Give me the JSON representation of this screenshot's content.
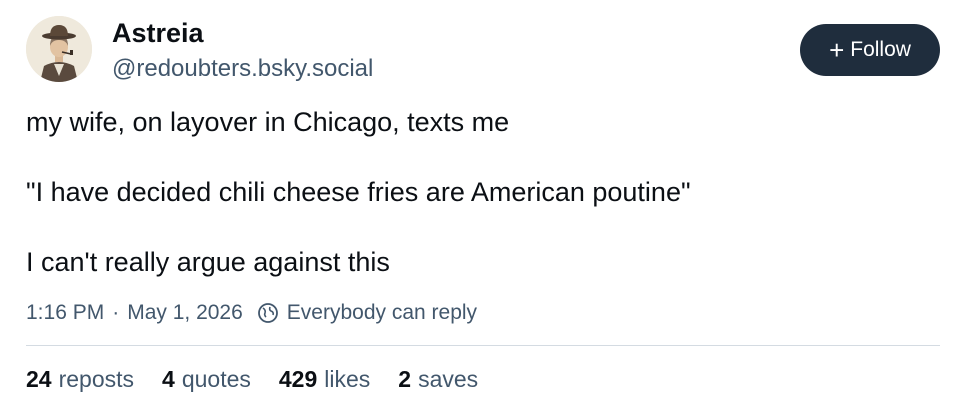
{
  "author": {
    "display_name": "Astreia",
    "handle": "@redoubters.bsky.social",
    "avatar_icon": "avatar-image"
  },
  "follow": {
    "icon": "+",
    "label": "Follow",
    "bg_color": "#1f2d3d"
  },
  "post": {
    "paragraphs": [
      "my wife, on layover in Chicago, texts me",
      "\"I have decided chili cheese fries are American poutine\"",
      "I can't really argue against this"
    ],
    "time": "1:16 PM",
    "separator": "·",
    "date": "May 1, 2026",
    "reply_setting": "Everybody can reply",
    "reply_setting_icon": "globe-icon"
  },
  "stats": [
    {
      "count": "24",
      "label": "reposts"
    },
    {
      "count": "4",
      "label": "quotes"
    },
    {
      "count": "429",
      "label": "likes"
    },
    {
      "count": "2",
      "label": "saves"
    }
  ],
  "colors": {
    "text": "#0b0f14",
    "muted": "#42576c",
    "divider": "#d4dbe2"
  }
}
